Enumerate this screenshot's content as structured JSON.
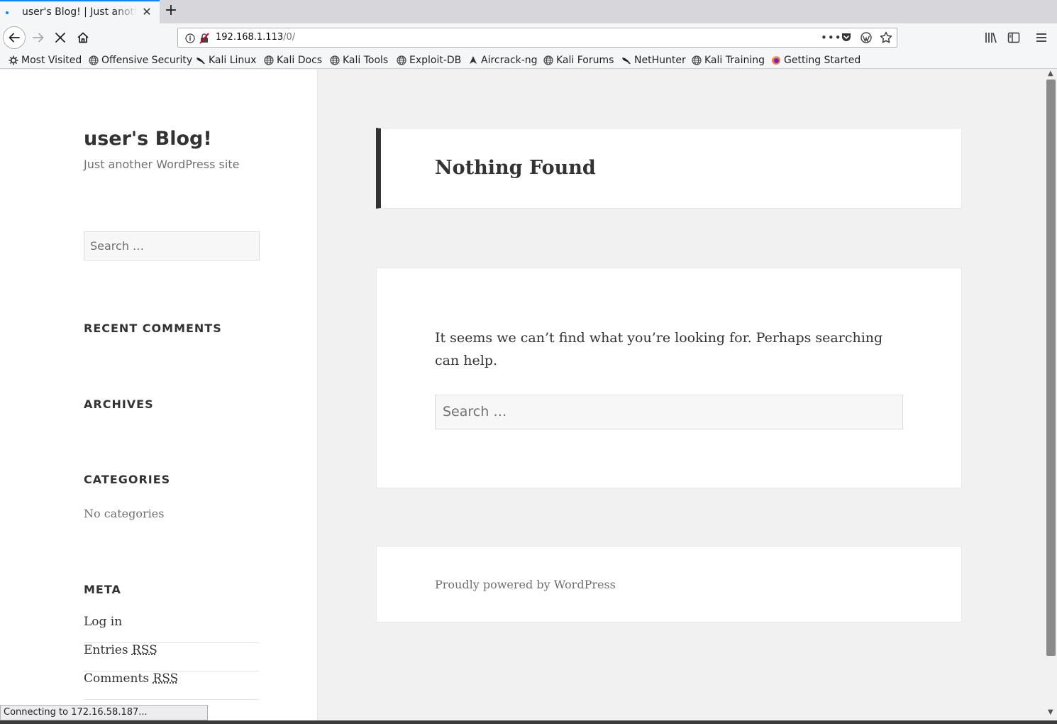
{
  "tab": {
    "title": "user's Blog! | Just another WordPress site",
    "close_glyph": "✕",
    "new_tab_glyph": "+"
  },
  "url": {
    "host": "192.168.1.113",
    "path": "/0/"
  },
  "icons": {
    "back": "back-arrow-icon",
    "forward": "forward-arrow-icon",
    "stop": "stop-icon",
    "home": "home-icon",
    "info": "info-icon",
    "insecure": "insecure-lock-icon",
    "page_actions": "•••",
    "pocket": "pocket-icon",
    "wordpress": "wordpress-icon",
    "bookmark_star": "star-icon",
    "library": "library-icon",
    "sidebar": "sidebar-icon",
    "menu": "hamburger-menu-icon"
  },
  "bookmarks": [
    {
      "label": "Most Visited",
      "icon": "gear-icon"
    },
    {
      "label": "Offensive Security",
      "icon": "globe-icon"
    },
    {
      "label": "Kali Linux",
      "icon": "kali-dragon-icon"
    },
    {
      "label": "Kali Docs",
      "icon": "globe-icon"
    },
    {
      "label": "Kali Tools",
      "icon": "globe-icon"
    },
    {
      "label": "Exploit-DB",
      "icon": "globe-icon"
    },
    {
      "label": "Aircrack-ng",
      "icon": "aircrack-icon"
    },
    {
      "label": "Kali Forums",
      "icon": "globe-icon"
    },
    {
      "label": "NetHunter",
      "icon": "kali-dragon-icon"
    },
    {
      "label": "Kali Training",
      "icon": "globe-icon"
    },
    {
      "label": "Getting Started",
      "icon": "firefox-icon"
    }
  ],
  "sidebar": {
    "site_title": "user's Blog!",
    "site_description": "Just another WordPress site",
    "search_placeholder": "Search …",
    "widgets": {
      "recent_comments": "RECENT COMMENTS",
      "archives": "ARCHIVES",
      "categories": "CATEGORIES",
      "no_categories": "No categories",
      "meta": "META"
    },
    "meta_links": [
      {
        "text": "Log in",
        "abbr": ""
      },
      {
        "text": "Entries ",
        "abbr": "RSS"
      },
      {
        "text": "Comments ",
        "abbr": "RSS"
      }
    ]
  },
  "main": {
    "heading": "Nothing Found",
    "message": "It seems we can’t find what you’re looking for. Perhaps searching can help.",
    "search_placeholder": "Search …",
    "footer": "Proudly powered by WordPress"
  },
  "status": "Connecting to 172.16.58.187...",
  "colors": {
    "accent_blue": "#0a84ff",
    "sidebar_bg": "#ffffff",
    "page_bg": "#f1f1f1",
    "heading_border": "#333333",
    "insecure_red": "#d70022"
  }
}
